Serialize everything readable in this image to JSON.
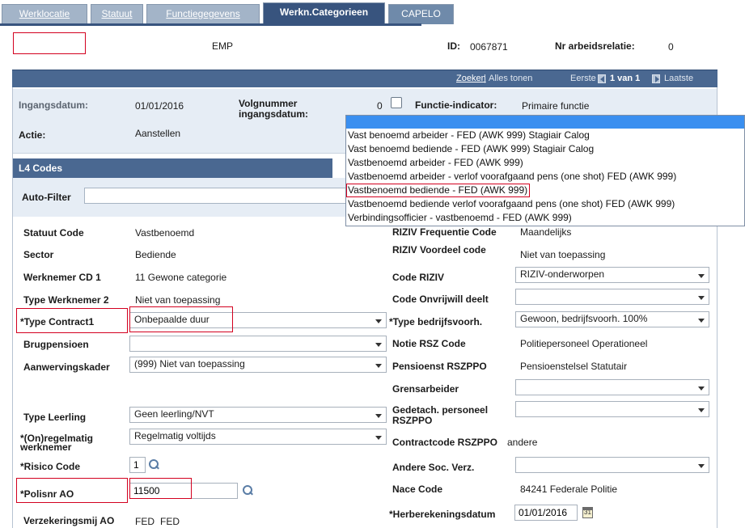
{
  "tabs": [
    {
      "label": "Werklocatie"
    },
    {
      "label": "Statuut"
    },
    {
      "label": "Functiegegevens"
    },
    {
      "label": "Werkn.Categorieen"
    },
    {
      "label": "CAPELO"
    }
  ],
  "header": {
    "emp_label": "EMP",
    "id_label": "ID:",
    "id_value": "0067871",
    "nr_label": "Nr arbeidsrelatie:",
    "nr_value": "0"
  },
  "navbar": {
    "zoeken": "Zoeken",
    "separator": "|",
    "alles_tonen": "Alles tonen",
    "eerste": "Eerste",
    "pager": "1 van 1",
    "laatste": "Laatste"
  },
  "summary": {
    "ingangsdatum_label": "Ingangsdatum:",
    "ingangsdatum_value": "01/01/2016",
    "volgnummer_label": "Volgnummer ingangsdatum:",
    "volgnummer_value": "0",
    "functie_label": "Functie-indicator:",
    "functie_value": "Primaire functie",
    "actie_label": "Actie:",
    "actie_value": "Aanstellen"
  },
  "l4": {
    "title": "L4 Codes",
    "auto_filter_label": "Auto-Filter",
    "left": {
      "statuut_code_label": "Statuut Code",
      "statuut_code_value": "Vastbenoemd",
      "sector_label": "Sector",
      "sector_value": "Bediende",
      "werknemer_cd1_label": "Werknemer CD 1",
      "werknemer_cd1_value": "11 Gewone categorie",
      "type_werknemer2_label": "Type Werknemer 2",
      "type_werknemer2_value": "Niet van toepassing",
      "type_contract1_label": "*Type Contract1",
      "type_contract1_value": "Onbepaalde duur",
      "brugpensioen_label": "Brugpensioen",
      "brugpensioen_value": "",
      "aanwervingskader_label": "Aanwervingskader",
      "aanwervingskader_value": "(999) Niet van toepassing",
      "type_leerling_label": "Type Leerling",
      "type_leerling_value": "Geen leerling/NVT",
      "onregelmatig_label": "*(On)regelmatig werknemer",
      "onregelmatig_value": "Regelmatig voltijds",
      "risico_label": "*Risico Code",
      "risico_value": "1",
      "polisnr_label": "*Polisnr AO",
      "polisnr_value": "11500",
      "verzekering_label": "Verzekeringsmij AO",
      "verzekering_value1": "FED",
      "verzekering_value2": "FED"
    },
    "right": {
      "riziv_freq_label": "RIZIV Frequentie Code",
      "riziv_freq_value": "Maandelijks",
      "riziv_voordeel_label": "RIZIV Voordeel code",
      "riziv_voordeel_value": "Niet van toepassing",
      "code_riziv_label": "Code RIZIV",
      "code_riziv_value": "RIZIV-onderworpen",
      "code_onvrijwill_label": "Code Onvrijwill deelt",
      "code_onvrijwill_value": "",
      "type_bedrijfs_label": "*Type bedrijfsvoorh.",
      "type_bedrijfs_value": "Gewoon, bedrijfsvoorh. 100%",
      "notie_rsz_label": "Notie RSZ Code",
      "notie_rsz_value": "Politiepersoneel Operationeel",
      "pensioenst_label": "Pensioenst RSZPPO",
      "pensioenst_value": "Pensioenstelsel Statutair",
      "grensarbeider_label": "Grensarbeider",
      "grensarbeider_value": "",
      "gedetach_label": "Gedetach. personeel RSZPPO",
      "gedetach_value": "",
      "contractcode_label": "Contractcode RSZPPO",
      "contractcode_value": "andere",
      "andere_soc_label": "Andere Soc. Verz.",
      "andere_soc_value": "",
      "nace_label": "Nace Code",
      "nace_value": "84241 Federale Politie",
      "herberekening_label": "*Herberekeningsdatum",
      "herberekening_value": "01/01/2016"
    }
  },
  "dropdown": {
    "items": [
      "Vast benoemd arbeider - FED (AWK 999) Stagiair Calog",
      "Vast benoemd bediende - FED (AWK 999) Stagiair Calog",
      "Vastbenoemd arbeider - FED (AWK 999)",
      "Vastbenoemd arbeider - verlof voorafgaand pens (one shot) FED (AWK 999)",
      "Vastbenoemd bediende - FED (AWK 999)",
      "Vastbenoemd bediende verlof voorafgaand pens (one shot) FED (AWK 999)",
      "Verbindingsofficier - vastbenoemd - FED (AWK 999)"
    ],
    "highlighted_index": 4
  },
  "colors": {
    "highlight_red": "#d3001f",
    "tab_active": "#38547e",
    "navbar": "#4a6891",
    "dropdown_header": "#3a8ff0"
  }
}
